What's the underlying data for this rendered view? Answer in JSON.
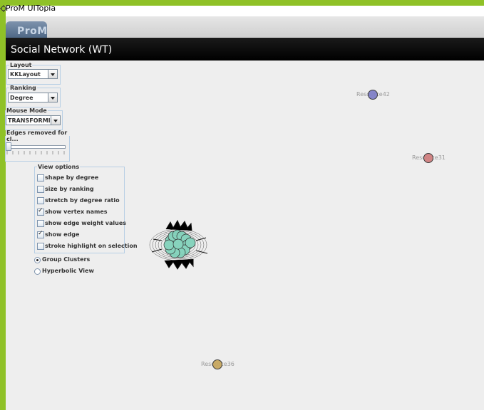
{
  "window": {
    "app_title": "ProM UITopia",
    "logo_text": "ProM"
  },
  "view": {
    "title": "Social Network (WT)"
  },
  "controls": {
    "layout": {
      "label": "Layout",
      "value": "KKLayout"
    },
    "ranking": {
      "label": "Ranking",
      "value": "Degree"
    },
    "mouse_mode": {
      "label": "Mouse Mode",
      "value": "TRANSFORMING"
    },
    "edges_removed": {
      "label": "Edges removed for cl...",
      "slider_value_fraction": 0.0
    },
    "view_options": {
      "label": "View options",
      "items": [
        {
          "label": "shape by degree",
          "checked": false
        },
        {
          "label": "size by ranking",
          "checked": false
        },
        {
          "label": "stretch by degree ratio",
          "checked": false
        },
        {
          "label": "show vertex names",
          "checked": true
        },
        {
          "label": "show edge weight values",
          "checked": false
        },
        {
          "label": "show edge",
          "checked": true
        },
        {
          "label": "stroke highlight on selection",
          "checked": false
        }
      ]
    },
    "view_mode": {
      "options": [
        {
          "label": "Group Clusters",
          "selected": true
        },
        {
          "label": "Hyperbolic View",
          "selected": false
        }
      ]
    }
  },
  "graph": {
    "vertices": [
      {
        "label": "Resource42",
        "color": "#8080c8"
      },
      {
        "label": "Resource31",
        "color": "#d08080"
      },
      {
        "label": "Resource36",
        "color": "#c8a860"
      }
    ],
    "cluster_color": "#7fd1b9"
  },
  "colors": {
    "frame_accent": "#8fc127",
    "header_bg": "#000000",
    "canvas_bg": "#eeeeee"
  }
}
